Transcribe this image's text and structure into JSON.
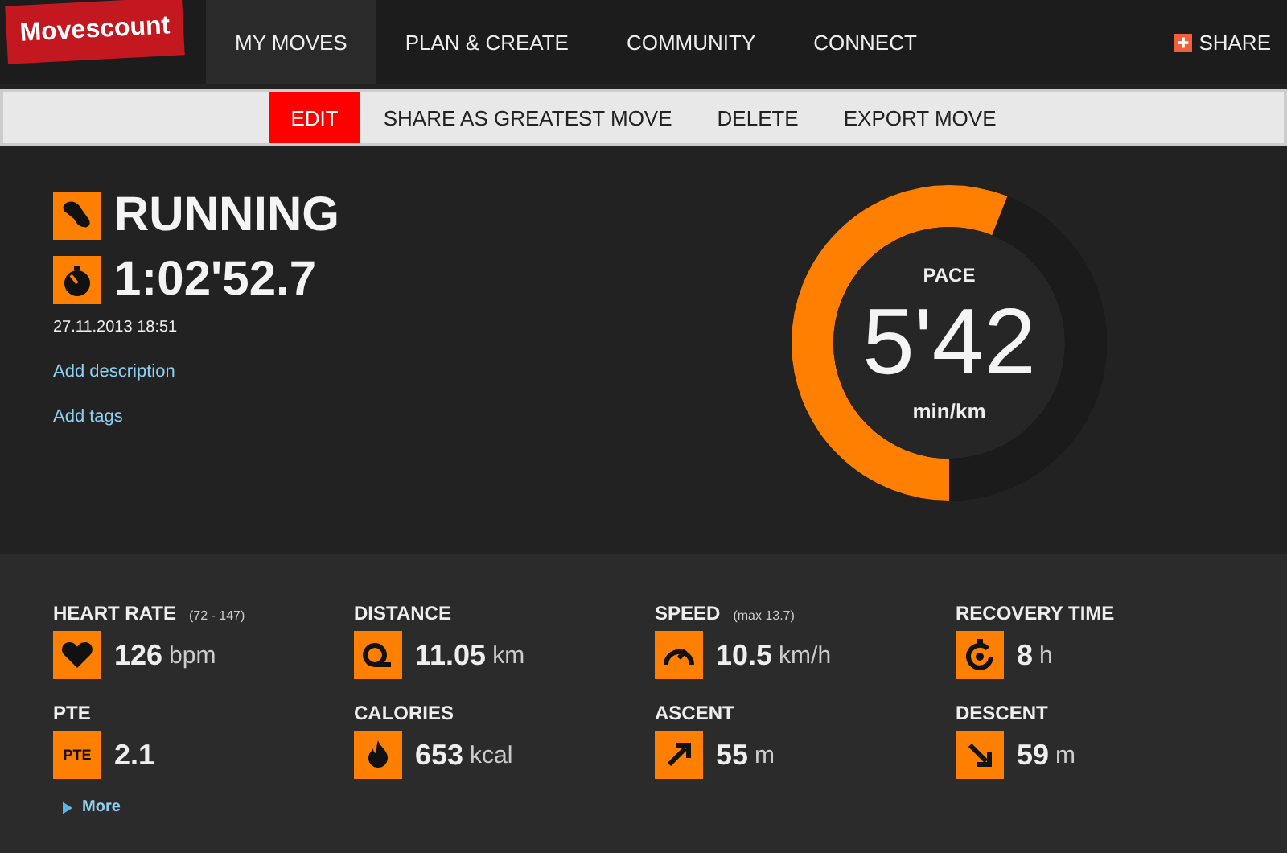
{
  "logo": "Movescount",
  "nav": [
    {
      "label": "MY MOVES",
      "selected": true
    },
    {
      "label": "PLAN & CREATE",
      "selected": false
    },
    {
      "label": "COMMUNITY",
      "selected": false
    },
    {
      "label": "CONNECT",
      "selected": false
    }
  ],
  "share": "SHARE",
  "actions": [
    {
      "label": "EDIT",
      "selected": true
    },
    {
      "label": "SHARE AS GREATEST MOVE",
      "selected": false
    },
    {
      "label": "DELETE",
      "selected": false
    },
    {
      "label": "EXPORT MOVE",
      "selected": false
    }
  ],
  "move": {
    "sport": "RUNNING",
    "duration": "1:02'52.7",
    "date": "27.11.2013 18:51",
    "links": [
      "Add description",
      "Add tags"
    ]
  },
  "gauge": {
    "label": "PACE",
    "value": "5'42",
    "unit": "min/km",
    "level": 0.56
  },
  "stats": [
    {
      "label": "HEART RATE",
      "note": "(72 - 147)",
      "kind": "heart",
      "value": "126",
      "unit": "bpm"
    },
    {
      "label": "DISTANCE",
      "kind": "tape",
      "value": "11.05",
      "unit": "km"
    },
    {
      "label": "SPEED",
      "note": "(max 13.7)",
      "kind": "speed",
      "value": "10.5",
      "unit": "km/h"
    },
    {
      "label": "RECOVERY TIME",
      "kind": "recovery",
      "value": "8",
      "unit": "h"
    },
    {
      "label": "PTE",
      "kind": "text",
      "icon_text": "PTE",
      "value": "2.1"
    },
    {
      "label": "CALORIES",
      "kind": "flame",
      "value": "653",
      "unit": "kcal"
    },
    {
      "label": "ASCENT",
      "kind": "up",
      "value": "55",
      "unit": "m"
    },
    {
      "label": "DESCENT",
      "kind": "down",
      "value": "59",
      "unit": "m"
    }
  ],
  "more": "More"
}
